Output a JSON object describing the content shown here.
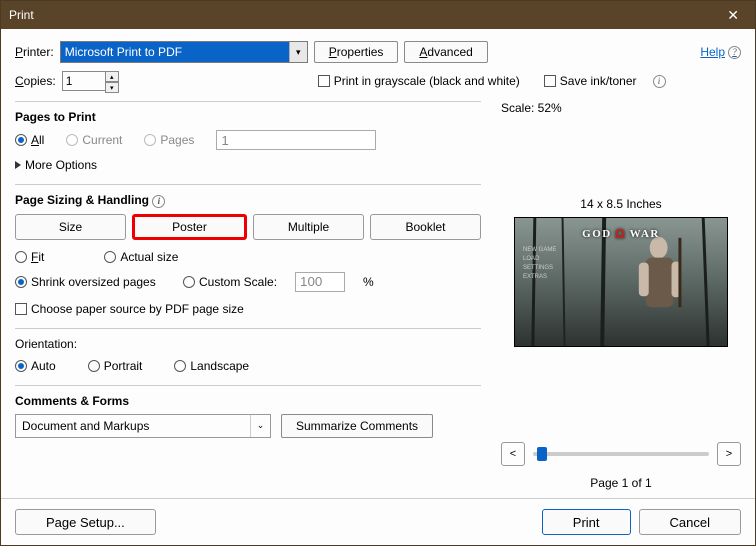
{
  "window": {
    "title": "Print"
  },
  "top": {
    "printer_label": "Printer:",
    "printer_value": "Microsoft Print to PDF",
    "properties": "Properties",
    "advanced": "Advanced",
    "help": "Help",
    "copies_label": "Copies:",
    "copies_value": "1",
    "grayscale": "Print in grayscale (black and white)",
    "save_ink": "Save ink/toner"
  },
  "pages": {
    "title": "Pages to Print",
    "all": "All",
    "current": "Current",
    "pages": "Pages",
    "pages_value": "1",
    "more_options": "More Options"
  },
  "sizing": {
    "title": "Page Sizing & Handling",
    "size": "Size",
    "poster": "Poster",
    "multiple": "Multiple",
    "booklet": "Booklet",
    "fit": "Fit",
    "actual": "Actual size",
    "shrink": "Shrink oversized pages",
    "custom_scale": "Custom Scale:",
    "custom_scale_value": "100",
    "percent": "%",
    "choose_paper": "Choose paper source by PDF page size"
  },
  "orientation": {
    "title": "Orientation:",
    "auto": "Auto",
    "portrait": "Portrait",
    "landscape": "Landscape"
  },
  "comments": {
    "title": "Comments & Forms",
    "value": "Document and Markups",
    "summarize": "Summarize Comments"
  },
  "preview": {
    "scale": "Scale:  52%",
    "dimensions": "14 x 8.5 Inches",
    "caption_text": "GOD OF WAR",
    "page_label": "Page 1 of 1"
  },
  "footer": {
    "page_setup": "Page Setup...",
    "print": "Print",
    "cancel": "Cancel"
  }
}
